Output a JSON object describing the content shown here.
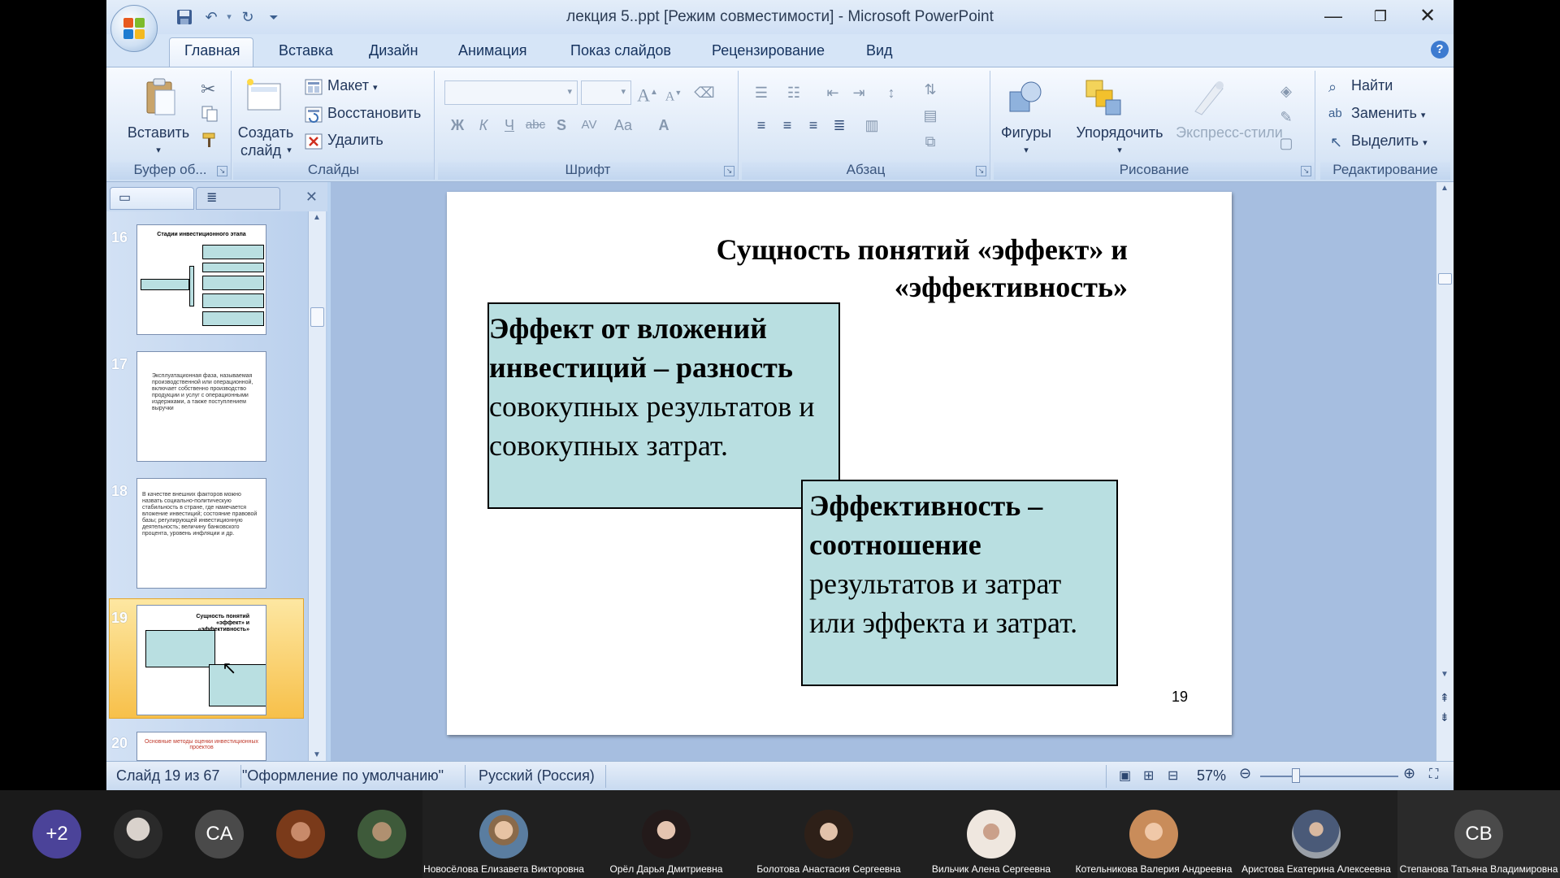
{
  "window": {
    "title": "лекция 5..ppt [Режим совместимости] - Microsoft PowerPoint"
  },
  "ribbon_tabs": [
    "Главная",
    "Вставка",
    "Дизайн",
    "Анимация",
    "Показ слайдов",
    "Рецензирование",
    "Вид"
  ],
  "ribbon": {
    "clipboard": {
      "label": "Буфер об...",
      "paste": "Вставить"
    },
    "slides": {
      "label": "Слайды",
      "new_slide": "Создать",
      "new_slide2": "слайд",
      "layout": "Макет",
      "reset": "Восстановить",
      "delete": "Удалить"
    },
    "font": {
      "label": "Шрифт",
      "bold": "Ж",
      "italic": "К",
      "underline": "Ч",
      "strike": "abc",
      "shadow": "S",
      "spacing": "AV",
      "case": "Aa",
      "color": "A"
    },
    "paragraph": {
      "label": "Абзац"
    },
    "drawing": {
      "label": "Рисование",
      "shapes": "Фигуры",
      "arrange": "Упорядочить",
      "quick_styles": "Экспресс-стили"
    },
    "editing": {
      "label": "Редактирование",
      "find": "Найти",
      "replace": "Заменить",
      "select": "Выделить"
    }
  },
  "thumbnails": [
    {
      "number": "16",
      "title": "Стадии инвестиционного этапа"
    },
    {
      "number": "17",
      "title": "Эксплуатационная фаза, называемая производственной или операционной, включает собственно производство продукции и услуг с операционными издержками, а также поступлением выручки"
    },
    {
      "number": "18",
      "title": "В качестве внешних факторов можно назвать социально-политическую стабильность в стране, где намечается вложение инвестиций; состояние правовой базы; регулирующей инвестиционную деятельность; величину банковского процента, уровень инфляции и др."
    },
    {
      "number": "19",
      "title": "Сущность понятий «эффект» и «эффективность»",
      "selected": true
    },
    {
      "number": "20",
      "title": "Основные методы оценки инвестиционных проектов"
    }
  ],
  "slide": {
    "title": "Сущность понятий «эффект» и «эффективность»",
    "box1_bold": "Эффект от вложений инвестиций –  разность",
    "box1_rest": "совокупных результатов и совокупных затрат.",
    "box2_bold": "Эффективность – соотношение",
    "box2_rest": "результатов и затрат или эффекта и затрат.",
    "number": "19"
  },
  "status": {
    "slide_of": "Слайд 19 из 67",
    "theme": "\"Оформление по умолчанию\"",
    "language": "Русский (Россия)",
    "zoom": "57%"
  },
  "meeting": {
    "overflow": "+2",
    "participants": [
      {
        "initials": "",
        "name": "",
        "photo_color": "#5a5a5a"
      },
      {
        "initials": "CA",
        "name": "",
        "color": "#4a4a4a"
      },
      {
        "initials": "",
        "name": "",
        "photo_color": "#8a4a2a"
      },
      {
        "initials": "",
        "name": "",
        "photo_color": "#4a5a3a"
      },
      {
        "initials": "",
        "name": "Новосёлова Елизавета Викторовна",
        "photo_color": "#6a7f9a"
      },
      {
        "initials": "",
        "name": "Орёл Дарья Дмитриевна",
        "photo_color": "#3a3030"
      },
      {
        "initials": "",
        "name": "Болотова Анастасия Сергеевна",
        "photo_color": "#3a2a22"
      },
      {
        "initials": "",
        "name": "Вильчик Алена Сергеевна",
        "photo_color": "#cfc4b8"
      },
      {
        "initials": "",
        "name": "Котельникова Валерия Андреевна",
        "photo_color": "#d9a070"
      },
      {
        "initials": "",
        "name": "Аристова Екатерина Алексеевна",
        "photo_color": "#6a7080"
      },
      {
        "initials": "CB",
        "name": "Степанова Татьяна Владимировна",
        "color": "#4a4a4a"
      }
    ]
  }
}
